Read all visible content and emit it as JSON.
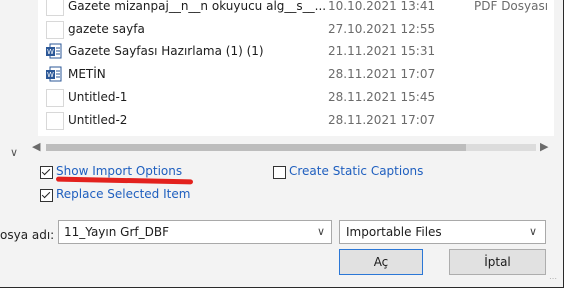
{
  "files": [
    {
      "name": "Gazete mizanpaj__n__n okuyucu alg__s__...",
      "date": "10.10.2021 13:41",
      "type": "PDF Dosyası",
      "icon": "plain-file-icon"
    },
    {
      "name": "gazete sayfa",
      "date": "27.10.2021 12:55",
      "type": "",
      "icon": "plain-file-icon"
    },
    {
      "name": "Gazete Sayfası Hazırlama (1) (1)",
      "date": "21.11.2021 15:31",
      "type": "",
      "icon": "word-document-icon"
    },
    {
      "name": "METİN",
      "date": "28.11.2021 17:07",
      "type": "",
      "icon": "word-document-icon"
    },
    {
      "name": "Untitled-1",
      "date": "28.11.2021 15:45",
      "type": "",
      "icon": "plain-file-icon"
    },
    {
      "name": "Untitled-2",
      "date": "28.11.2021 17:07",
      "type": "",
      "icon": "plain-file-icon"
    }
  ],
  "options": {
    "show_import_options": {
      "label": "Show Import Options",
      "checked": true
    },
    "create_static_captions": {
      "label": "Create Static Captions",
      "checked": false
    },
    "replace_selected_item": {
      "label": "Replace Selected Item",
      "checked": true
    }
  },
  "filename": {
    "label": "osya adı:",
    "value": "11_Yayın Grf_DBF"
  },
  "filetype": {
    "value": "Importable Files"
  },
  "buttons": {
    "open": "Aç",
    "cancel": "İptal"
  },
  "colors": {
    "link": "#1f5fbf",
    "annotation_underline": "#e3211d",
    "list_bg": "#ffffff"
  }
}
